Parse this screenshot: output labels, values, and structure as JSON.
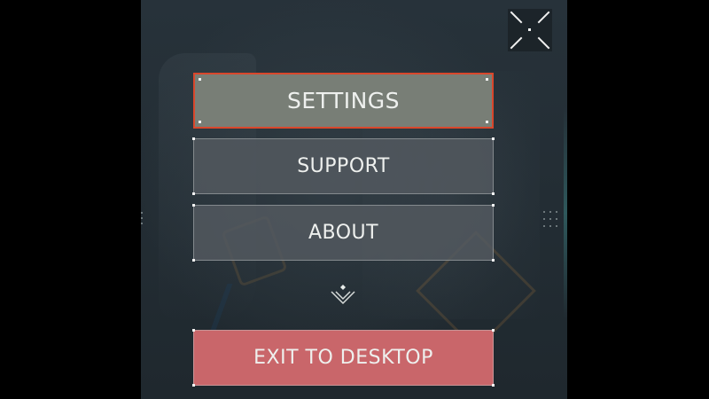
{
  "menu": {
    "items": [
      {
        "label": "SETTINGS",
        "state": "selected"
      },
      {
        "label": "SUPPORT",
        "state": "default"
      },
      {
        "label": "ABOUT",
        "state": "default"
      }
    ],
    "exit_label": "EXIT TO DESKTOP"
  },
  "icons": {
    "top_right": "fullscreen-toggle-icon",
    "center": "expand-more-chevron-icon"
  },
  "colors": {
    "panel_background": "#232d34",
    "selected_button": "#787e76",
    "selected_border": "#d9472c",
    "default_button": "#545a60",
    "exit_button": "#c9666a",
    "text": "#eef0ee"
  }
}
